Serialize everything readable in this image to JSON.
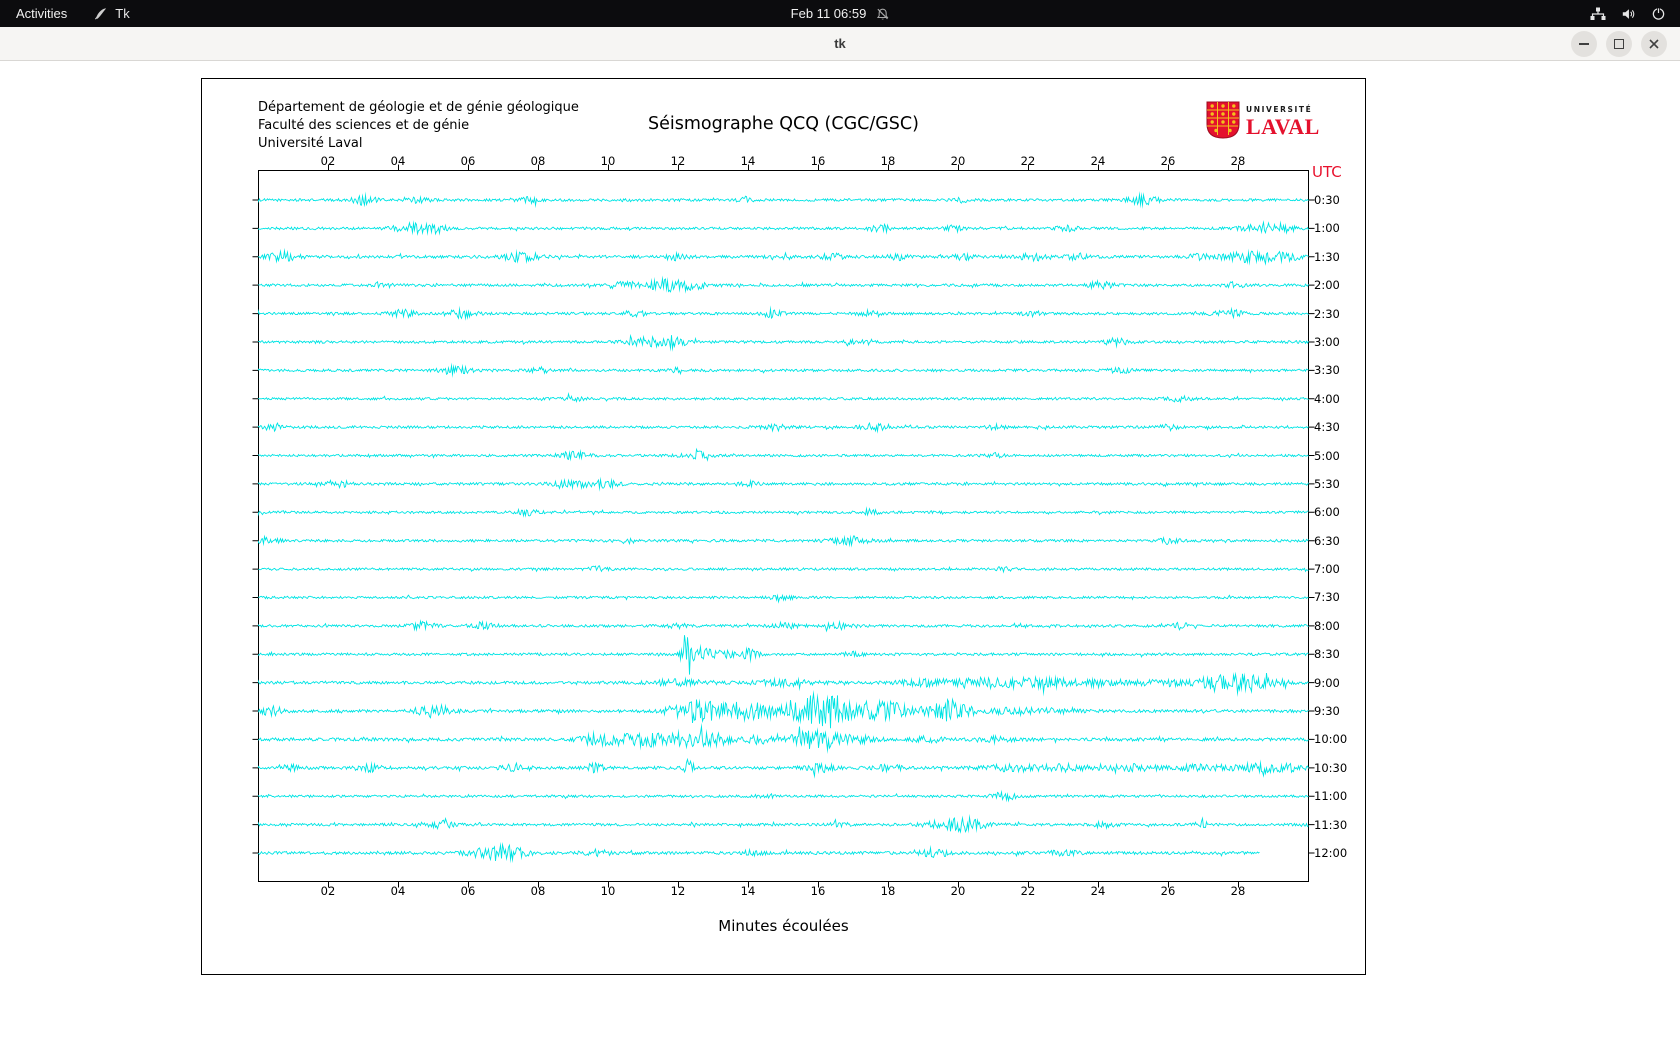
{
  "topbar": {
    "activities": "Activities",
    "app_name": "Tk",
    "clock": "Feb 11 06:59",
    "icons": [
      "network-icon",
      "volume-icon",
      "power-icon"
    ],
    "notifications_icon": "bell-muted-icon"
  },
  "titlebar": {
    "title": "tk",
    "controls": [
      "minimize",
      "restore",
      "close"
    ]
  },
  "seismograph": {
    "header_lines": [
      "Département de géologie et de génie géologique",
      "Faculté des sciences et de génie",
      "Université Laval"
    ],
    "title": "Séismographe QCQ (CGC/GSC)",
    "logo": {
      "small_text": "UNIVERSITÉ",
      "big_text": "LAVAL"
    },
    "utc_label": "UTC",
    "xlabel": "Minutes écoulées",
    "trace_color": "#00e4e4",
    "brand_red": "#e4112d",
    "logo_gold": "#f2c21c"
  },
  "chart_data": {
    "type": "line",
    "title": "Séismographe QCQ (CGC/GSC)",
    "xlabel": "Minutes écoulées",
    "x_range": [
      0,
      30
    ],
    "x_ticks": [
      "02",
      "04",
      "06",
      "08",
      "10",
      "12",
      "14",
      "16",
      "18",
      "20",
      "22",
      "24",
      "26",
      "28"
    ],
    "trace_labels": [
      "0:30",
      "1:00",
      "1:30",
      "2:00",
      "2:30",
      "3:00",
      "3:30",
      "4:00",
      "4:30",
      "5:00",
      "5:30",
      "6:00",
      "6:30",
      "7:00",
      "7:30",
      "8:00",
      "8:30",
      "9:00",
      "9:30",
      "10:00",
      "10:30",
      "11:00",
      "11:30",
      "12:00"
    ],
    "note": "24 half-hour seismogram traces, UTC; low background noise with event bursts encoded as [minute, amplitude_px, width_min]",
    "traces": [
      {
        "base": 1.3,
        "end": 30,
        "bursts": [
          [
            3.0,
            4,
            0.25
          ],
          [
            4.6,
            2.5,
            0.2
          ],
          [
            7.7,
            2.5,
            0.2
          ],
          [
            13.9,
            2.5,
            0.15
          ],
          [
            20.1,
            2,
            0.15
          ],
          [
            25.3,
            4.5,
            0.3
          ]
        ]
      },
      {
        "base": 1.3,
        "end": 30,
        "bursts": [
          [
            4.4,
            4.5,
            0.4
          ],
          [
            5.1,
            3,
            0.2
          ],
          [
            17.8,
            3.5,
            0.25
          ],
          [
            19.9,
            2.5,
            0.2
          ],
          [
            23.1,
            2.5,
            0.2
          ],
          [
            28.9,
            5,
            0.5
          ]
        ]
      },
      {
        "base": 1.5,
        "end": 30,
        "bursts": [
          [
            0.7,
            4.5,
            0.3
          ],
          [
            7.5,
            4.5,
            0.35
          ],
          [
            12.0,
            3,
            0.2
          ],
          [
            14.9,
            3.5,
            0.2
          ],
          [
            16.4,
            3,
            0.2
          ],
          [
            18.3,
            2.5,
            0.2
          ],
          [
            20.2,
            3.5,
            0.2
          ],
          [
            22.1,
            3.5,
            0.25
          ],
          [
            23.4,
            3,
            0.2
          ],
          [
            26.8,
            3,
            0.2
          ],
          [
            28.2,
            4.5,
            0.5
          ],
          [
            29.3,
            4,
            0.3
          ]
        ]
      },
      {
        "base": 1.3,
        "end": 30,
        "bursts": [
          [
            3.5,
            2.5,
            0.2
          ],
          [
            10.4,
            3.5,
            0.3
          ],
          [
            11.5,
            3,
            0.3
          ],
          [
            12.1,
            4.5,
            0.5
          ],
          [
            24.1,
            3.5,
            0.25
          ],
          [
            27.9,
            2.5,
            0.2
          ]
        ]
      },
      {
        "base": 1.3,
        "end": 30,
        "bursts": [
          [
            4.1,
            3.5,
            0.25
          ],
          [
            5.8,
            3.5,
            0.3
          ],
          [
            10.8,
            2.5,
            0.2
          ],
          [
            14.7,
            3.5,
            0.2
          ],
          [
            17.4,
            2.5,
            0.2
          ],
          [
            22.1,
            2.5,
            0.2
          ],
          [
            27.7,
            3.5,
            0.3
          ]
        ]
      },
      {
        "base": 1.3,
        "end": 30,
        "bursts": [
          [
            11.3,
            4.5,
            0.5
          ],
          [
            11.8,
            3,
            0.3
          ],
          [
            17.0,
            2,
            0.2
          ],
          [
            24.5,
            3,
            0.25
          ]
        ]
      },
      {
        "base": 1.3,
        "end": 30,
        "bursts": [
          [
            5.6,
            3.5,
            0.3
          ],
          [
            8.0,
            2.5,
            0.2
          ],
          [
            11.9,
            2,
            0.2
          ],
          [
            24.6,
            3,
            0.2
          ]
        ]
      },
      {
        "base": 1.2,
        "end": 30,
        "bursts": [
          [
            9.0,
            1.8,
            0.2
          ],
          [
            26.3,
            2.5,
            0.25
          ]
        ]
      },
      {
        "base": 1.3,
        "end": 30,
        "bursts": [
          [
            0.4,
            3.5,
            0.2
          ],
          [
            14.8,
            3.5,
            0.25
          ],
          [
            17.6,
            3.5,
            0.25
          ],
          [
            21.0,
            2,
            0.2
          ],
          [
            26.0,
            2.5,
            0.2
          ]
        ]
      },
      {
        "base": 1.2,
        "end": 30,
        "bursts": [
          [
            9.0,
            3.5,
            0.3
          ],
          [
            12.5,
            3.5,
            0.3
          ],
          [
            21.0,
            2,
            0.2
          ]
        ]
      },
      {
        "base": 1.3,
        "end": 30,
        "bursts": [
          [
            2.3,
            3.5,
            0.25
          ],
          [
            9.0,
            3,
            0.4
          ],
          [
            9.9,
            2.8,
            0.3
          ],
          [
            14.0,
            2,
            0.2
          ]
        ]
      },
      {
        "base": 1.2,
        "end": 30,
        "bursts": [
          [
            7.7,
            2.8,
            0.25
          ],
          [
            17.5,
            1.8,
            0.2
          ]
        ]
      },
      {
        "base": 1.3,
        "end": 30,
        "bursts": [
          [
            0.3,
            3.5,
            0.2
          ],
          [
            10.5,
            2,
            0.2
          ],
          [
            16.9,
            3.5,
            0.4
          ],
          [
            26.0,
            2.5,
            0.2
          ]
        ]
      },
      {
        "base": 1.2,
        "end": 30,
        "bursts": [
          [
            9.7,
            2.2,
            0.2
          ],
          [
            21.3,
            1.8,
            0.2
          ]
        ]
      },
      {
        "base": 1.2,
        "end": 30,
        "bursts": [
          [
            15.0,
            1.6,
            0.3
          ]
        ]
      },
      {
        "base": 1.3,
        "end": 30,
        "bursts": [
          [
            4.7,
            3.5,
            0.25
          ],
          [
            6.4,
            3.5,
            0.2
          ],
          [
            12.0,
            2,
            0.2
          ],
          [
            15.1,
            2.8,
            0.3
          ],
          [
            16.6,
            2.8,
            0.3
          ],
          [
            26.5,
            3.5,
            0.25
          ]
        ]
      },
      {
        "base": 1.3,
        "end": 30,
        "bursts": [
          [
            12.25,
            24,
            0.1
          ],
          [
            12.6,
            7,
            0.2
          ],
          [
            13.2,
            3.5,
            0.3
          ],
          [
            14.0,
            5,
            0.2
          ],
          [
            17.0,
            2,
            0.2
          ]
        ]
      },
      {
        "base": 1.5,
        "end": 30,
        "bursts": [
          [
            12.0,
            2.5,
            0.6
          ],
          [
            15.0,
            2.5,
            0.6
          ],
          [
            19.0,
            3,
            0.5
          ],
          [
            21.0,
            4.5,
            0.8
          ],
          [
            22.6,
            3.5,
            0.5
          ],
          [
            24.1,
            3.5,
            0.5
          ],
          [
            25.8,
            3.5,
            0.4
          ],
          [
            27.5,
            8,
            0.45
          ],
          [
            28.2,
            7,
            0.3
          ],
          [
            29.0,
            3,
            0.3
          ]
        ]
      },
      {
        "base": 1.5,
        "end": 30,
        "bursts": [
          [
            0.4,
            4.5,
            0.2
          ],
          [
            5.0,
            5.5,
            0.35
          ],
          [
            12.3,
            9,
            0.4
          ],
          [
            13.1,
            6,
            0.5
          ],
          [
            13.9,
            5,
            0.3
          ],
          [
            14.6,
            5.5,
            0.5
          ],
          [
            15.8,
            13,
            0.4
          ],
          [
            16.4,
            11,
            0.35
          ],
          [
            17.3,
            7,
            0.5
          ],
          [
            18.1,
            6,
            0.4
          ],
          [
            19.5,
            7.5,
            0.4
          ],
          [
            20.0,
            6,
            0.3
          ],
          [
            21.6,
            3,
            0.5
          ],
          [
            23.0,
            2.5,
            0.4
          ]
        ]
      },
      {
        "base": 1.6,
        "end": 30,
        "bursts": [
          [
            9.6,
            6,
            0.3
          ],
          [
            10.4,
            4.5,
            0.3
          ],
          [
            11.1,
            5,
            0.3
          ],
          [
            11.6,
            5,
            0.3
          ],
          [
            12.3,
            5.5,
            0.4
          ],
          [
            13.1,
            4.5,
            0.3
          ],
          [
            14.3,
            3.5,
            0.3
          ],
          [
            15.7,
            6.5,
            0.4
          ],
          [
            16.2,
            5.5,
            0.3
          ],
          [
            17.1,
            3.5,
            0.4
          ],
          [
            19.1,
            2.5,
            0.3
          ],
          [
            21.0,
            2,
            0.4
          ]
        ]
      },
      {
        "base": 1.5,
        "end": 30,
        "bursts": [
          [
            0.8,
            3.5,
            0.2
          ],
          [
            3.1,
            3.5,
            0.25
          ],
          [
            7.3,
            3.5,
            0.25
          ],
          [
            9.6,
            3.5,
            0.2
          ],
          [
            12.3,
            8,
            0.12
          ],
          [
            16.1,
            3.5,
            0.3
          ],
          [
            18.0,
            2.5,
            0.3
          ],
          [
            21.5,
            2.8,
            0.6
          ],
          [
            23.1,
            2.8,
            0.5
          ],
          [
            25.0,
            2.8,
            0.5
          ],
          [
            27.0,
            3.2,
            0.5
          ],
          [
            28.5,
            3.5,
            0.4
          ],
          [
            29.4,
            3.5,
            0.3
          ]
        ]
      },
      {
        "base": 1.2,
        "end": 30,
        "bursts": [
          [
            14.5,
            1.8,
            0.2
          ],
          [
            21.3,
            3.5,
            0.25
          ]
        ]
      },
      {
        "base": 1.3,
        "end": 30,
        "bursts": [
          [
            5.2,
            3.5,
            0.25
          ],
          [
            16.6,
            2.2,
            0.2
          ],
          [
            19.8,
            4.5,
            0.5
          ],
          [
            20.4,
            3.5,
            0.4
          ],
          [
            24.1,
            2.8,
            0.3
          ],
          [
            27.0,
            2,
            0.2
          ]
        ]
      },
      {
        "base": 1.5,
        "end": 28.6,
        "bursts": [
          [
            6.7,
            4.5,
            0.5
          ],
          [
            7.1,
            3.5,
            0.4
          ],
          [
            9.6,
            2.8,
            0.3
          ],
          [
            14.1,
            2.2,
            0.2
          ],
          [
            19.3,
            3.5,
            0.3
          ],
          [
            23.0,
            2,
            0.3
          ]
        ]
      }
    ]
  }
}
